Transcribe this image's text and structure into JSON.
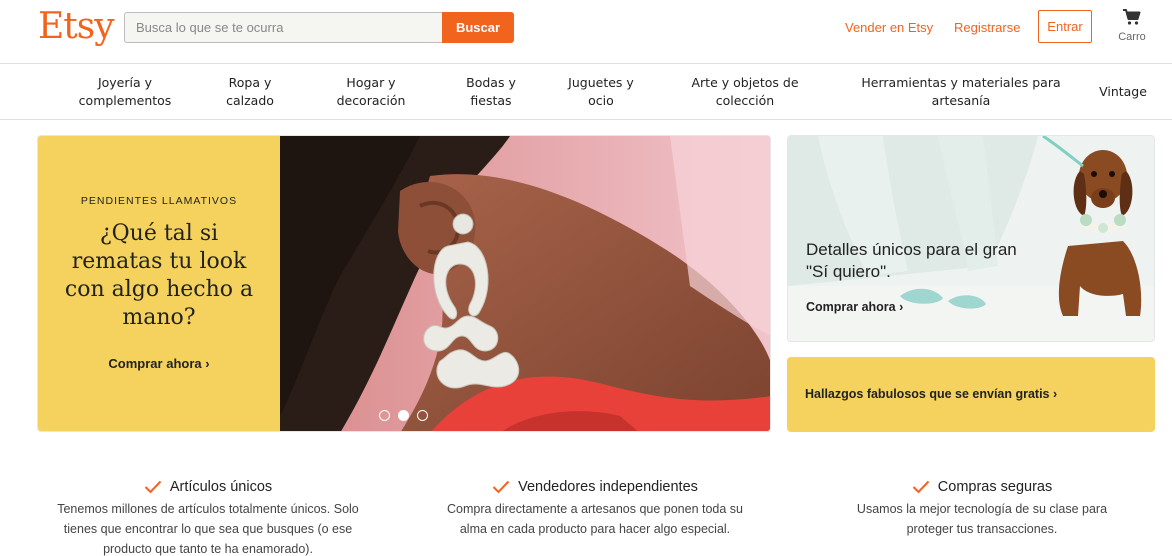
{
  "header": {
    "logo": "Etsy",
    "search_placeholder": "Busca lo que se te ocurra",
    "search_button": "Buscar",
    "sell_link": "Vender en Etsy",
    "register_link": "Registrarse",
    "signin_button": "Entrar",
    "cart_label": "Carro"
  },
  "categories": [
    "Joyería y\ncomplementos",
    "Ropa y\ncalzado",
    "Hogar y\ndecoración",
    "Bodas y\nfiestas",
    "Juguetes y\nocio",
    "Arte y objetos de\ncolección",
    "Herramientas y materiales para\nartesanía",
    "Vintage"
  ],
  "hero": {
    "eyebrow": "PENDIENTES LLAMATIVOS",
    "title": "¿Qué tal si rematas tu look con algo hecho a mano?",
    "cta": "Comprar ahora ›",
    "carousel_active_index": 1,
    "carousel_count": 3
  },
  "card_wedding": {
    "title": "Detalles únicos para el gran \"Sí quiero\".",
    "cta": "Comprar ahora ›"
  },
  "card_shipping": {
    "cta": "Hallazgos fabulosos que se envían gratis ›"
  },
  "value_props": [
    {
      "title": "Artículos únicos",
      "desc": "Tenemos millones de artículos totalmente únicos. Solo tienes que encontrar lo que sea que busques (o ese producto que tanto te ha enamorado)."
    },
    {
      "title": "Vendedores independientes",
      "desc": "Compra directamente a artesanos que ponen toda su alma en cada producto para hacer algo especial."
    },
    {
      "title": "Compras seguras",
      "desc": "Usamos la mejor tecnología de su clase para proteger tus transacciones."
    }
  ],
  "colors": {
    "brand_orange": "#f1641e",
    "promo_yellow": "#f5d25d"
  }
}
